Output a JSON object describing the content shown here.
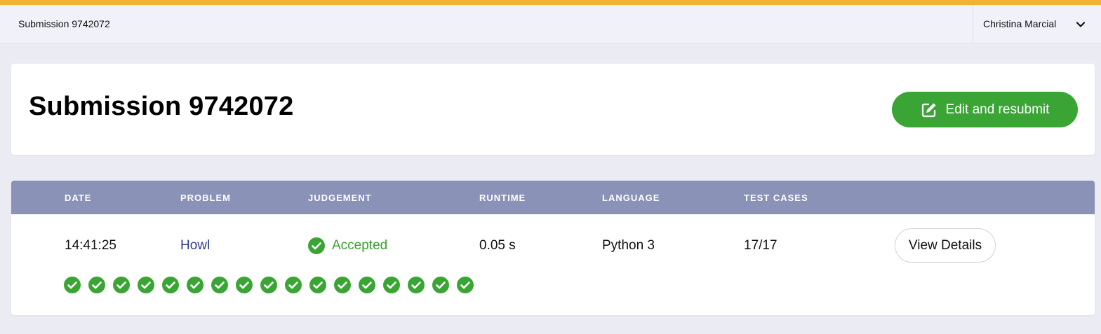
{
  "topbar": {
    "breadcrumb": "Submission 9742072",
    "user_name": "Christina Marcial",
    "user_menu_icon": "chevron-down-icon"
  },
  "header": {
    "title": "Submission 9742072",
    "resubmit_label": "Edit and resubmit",
    "resubmit_icon": "edit-icon"
  },
  "table": {
    "columns": [
      "DATE",
      "PROBLEM",
      "JUDGEMENT",
      "RUNTIME",
      "LANGUAGE",
      "TEST CASES"
    ],
    "row": {
      "date": "14:41:25",
      "problem": "Howl",
      "judgement": "Accepted",
      "runtime": "0.05 s",
      "language": "Python 3",
      "test_cases": "17/17",
      "details_label": "View Details"
    },
    "test_case_results": [
      "accepted",
      "accepted",
      "accepted",
      "accepted",
      "accepted",
      "accepted",
      "accepted",
      "accepted",
      "accepted",
      "accepted",
      "accepted",
      "accepted",
      "accepted",
      "accepted",
      "accepted",
      "accepted",
      "accepted"
    ]
  },
  "colors": {
    "accent_bar": "#f3b233",
    "success": "#3aa535",
    "table_header": "#8b92b8",
    "link": "#2c3f86"
  }
}
